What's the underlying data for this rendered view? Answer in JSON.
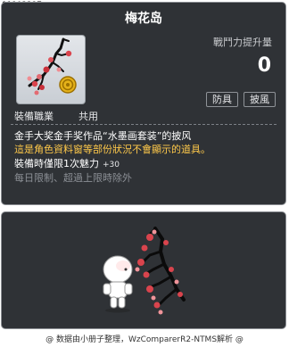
{
  "item_id": "01103397",
  "title": "梅花岛",
  "stat": {
    "label": "戰鬥力提升量",
    "value": "0"
  },
  "tags": [
    "防具",
    "披風"
  ],
  "job": {
    "label": "裝備職業",
    "value": "共用"
  },
  "description": {
    "line1": "金手大奖金手奖作品“水墨画套装”的披风",
    "line2": "這是角色資料窗等部份狀況不會顯示的道具。",
    "line3_main": "裝備時僅限1次魅力",
    "line3_bonus": "+30",
    "line4": "每日限制、超過上限時除外"
  },
  "footer": "@ 数据由小册子整理，WzComparerR2-NTMS解析 @",
  "colors": {
    "panel_bg": "#2f3236",
    "notice_yellow": "#ffc94a",
    "muted_gray": "#8c9096",
    "blossom_red": "#d9444d"
  },
  "icons": {
    "item_icon": "plum-blossom-cape-icon",
    "coin": "gold-coin-icon",
    "preview": "character-preview"
  }
}
